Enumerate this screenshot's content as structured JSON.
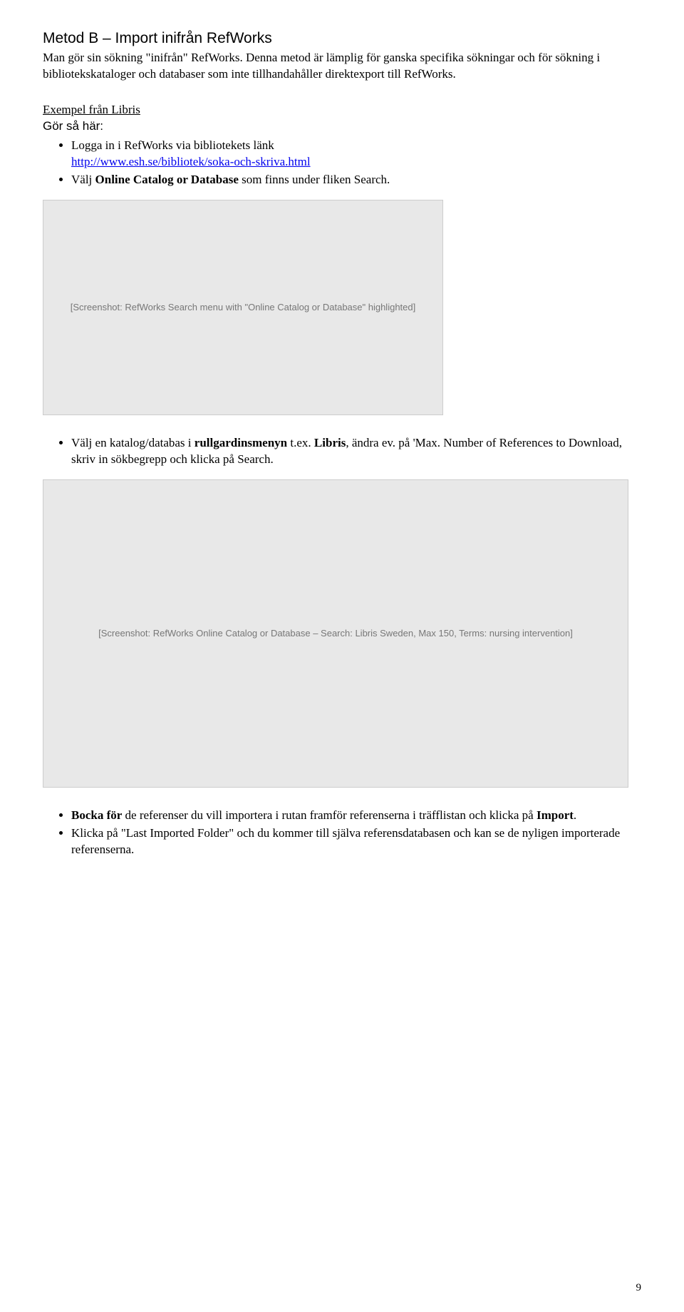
{
  "title": "Metod B – Import inifrån RefWorks",
  "intro": "Man gör sin sökning \"inifrån\" RefWorks. Denna metod är lämplig för ganska specifika sökningar och för sökning i bibliotekskataloger och databaser som inte tillhandahåller direktexport till RefWorks.",
  "example_heading": "Exempel från Libris",
  "gor_sa_har": "Gör så här:",
  "step1a": "Logga in i RefWorks via bibliotekets länk ",
  "step1_link": "http://www.esh.se/bibliotek/soka-och-skriva.html",
  "step2_pre": "Välj ",
  "step2_bold": "Online Catalog or Database",
  "step2_post": " som finns under fliken Search.",
  "img1_alt": "[Screenshot: RefWorks Search menu with \"Online Catalog or Database\" highlighted]",
  "step3_pre": "Välj en katalog/databas i ",
  "step3_bold1": "rullgardinsmenyn",
  "step3_mid": " t.ex. ",
  "step3_bold2": "Libris",
  "step3_post": ", ändra ev. på 'Max. Number of References to Download, skriv in sökbegrepp och klicka på Search.",
  "img2_alt": "[Screenshot: RefWorks Online Catalog or Database – Search: Libris Sweden, Max 150, Terms: nursing intervention]",
  "step4_pre": "Bocka för",
  "step4_mid": " de referenser du vill importera i rutan framför referenserna i träfflistan och klicka på ",
  "step4_bold2": "Import",
  "step4_post": ".",
  "step5": "Klicka på \"Last Imported Folder\" och du kommer till själva referensdatabasen och kan se de nyligen importerade referenserna.",
  "page_number": "9"
}
